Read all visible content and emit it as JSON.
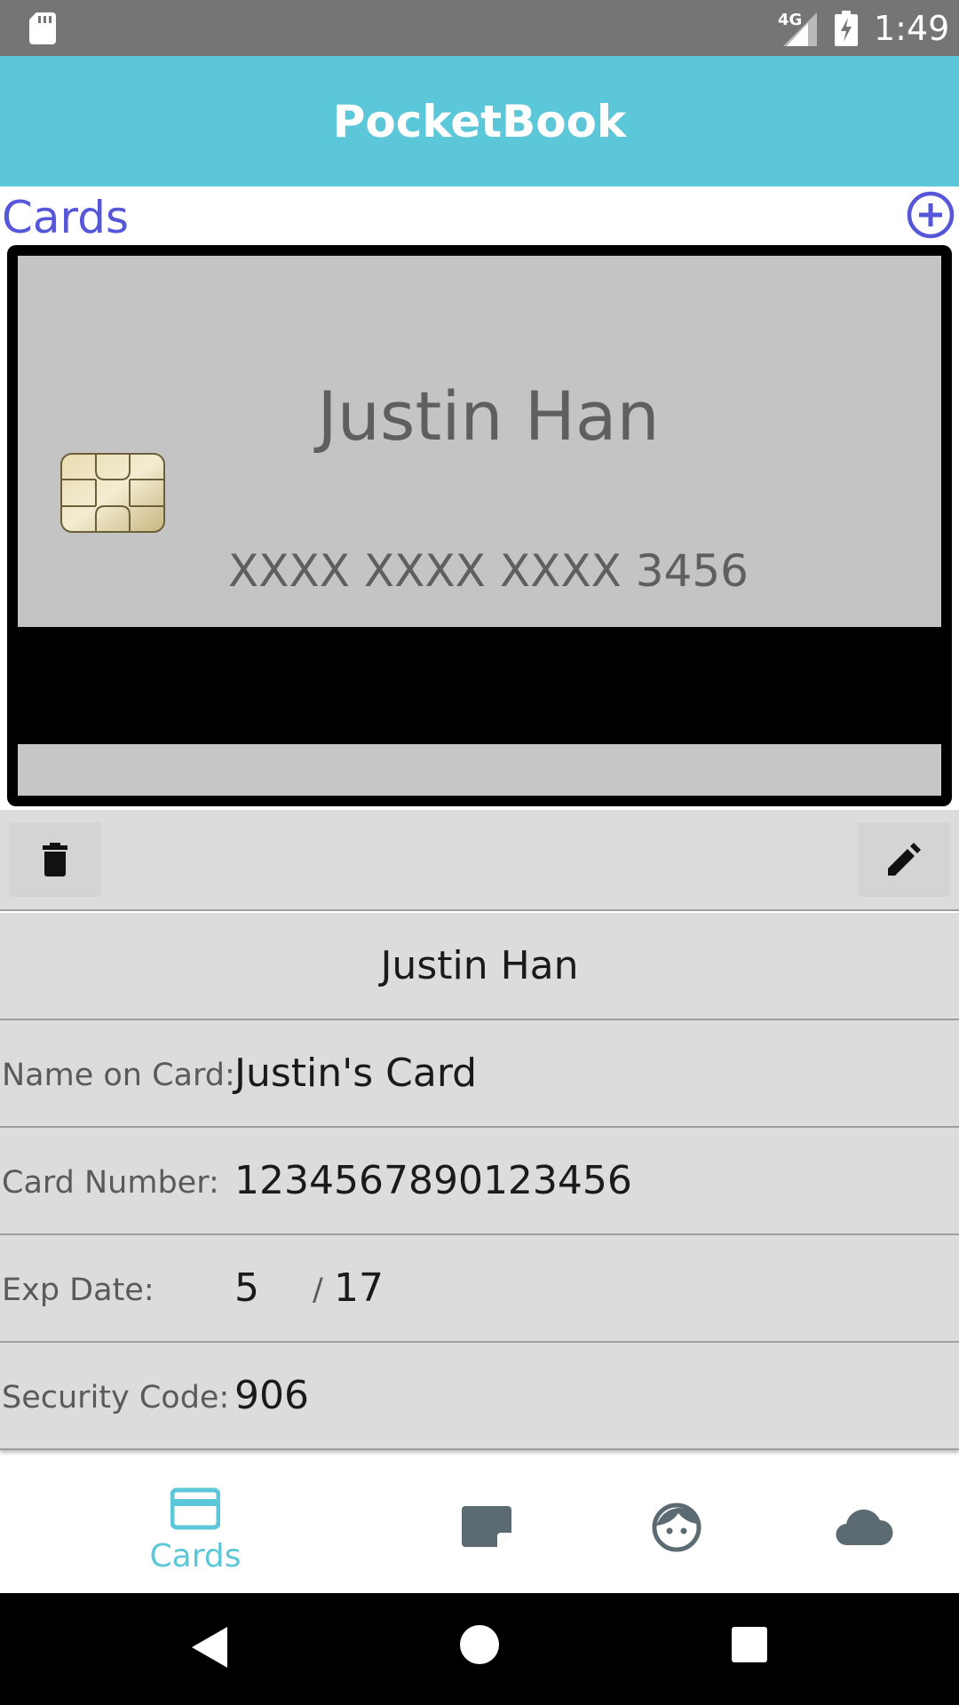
{
  "status_bar": {
    "network": "4G",
    "time": "1:49"
  },
  "app_bar": {
    "title": "PocketBook"
  },
  "section": {
    "title": "Cards",
    "add_icon": "add-circle-icon"
  },
  "card": {
    "holder_display": "Justin Han",
    "masked_number": "XXXX XXXX XXXX 3456"
  },
  "actions": {
    "delete_icon": "trash-icon",
    "edit_icon": "pencil-icon"
  },
  "details": {
    "title": "Justin Han",
    "name_on_card_label": "Name on Card:",
    "name_on_card_value": "Justin's Card",
    "card_number_label": "Card Number:",
    "card_number_value": "1234567890123456",
    "exp_date_label": "Exp Date:",
    "exp_month": "5",
    "exp_separator": "/",
    "exp_year": "17",
    "security_code_label": "Security Code:",
    "security_code_value": "906"
  },
  "bottom_nav": {
    "items": [
      {
        "label": "Cards",
        "icon": "credit-card-icon",
        "active": true
      },
      {
        "label": "",
        "icon": "note-icon",
        "active": false
      },
      {
        "label": "",
        "icon": "face-icon",
        "active": false
      },
      {
        "label": "",
        "icon": "cloud-icon",
        "active": false
      }
    ]
  },
  "colors": {
    "accent": "#5bc7d8",
    "section_title": "#5656d8",
    "row_bg": "#dcdcdc"
  }
}
